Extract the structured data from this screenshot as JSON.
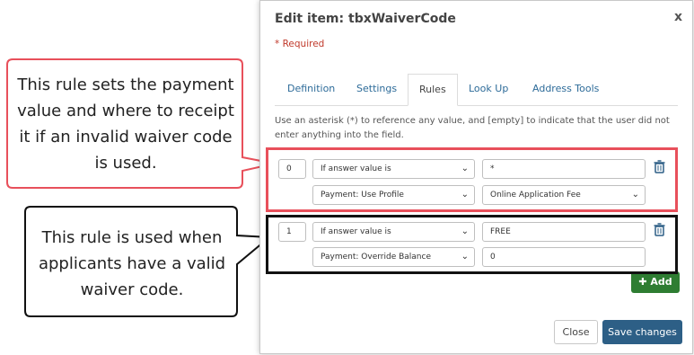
{
  "modal": {
    "title": "Edit item: tbxWaiverCode",
    "close_glyph": "x",
    "required_note": "* Required",
    "tabs": [
      {
        "label": "Definition",
        "active": false
      },
      {
        "label": "Settings",
        "active": false
      },
      {
        "label": "Rules",
        "active": true
      },
      {
        "label": "Look Up",
        "active": false
      },
      {
        "label": "Address Tools",
        "active": false
      }
    ],
    "instructions": "Use an asterisk (*) to reference any value, and [empty] to indicate that the user did not enter anything into the field.",
    "rules": [
      {
        "order": "0",
        "condition": "If answer value is",
        "value": "*",
        "action": "Payment: Use Profile",
        "action_value": "Online Application Fee"
      },
      {
        "order": "1",
        "condition": "If answer value is",
        "value": "FREE",
        "action": "Payment: Override Balance",
        "action_value": "0"
      }
    ],
    "add_label": "Add",
    "close_label": "Close",
    "save_label": "Save changes",
    "colors": {
      "add": "#2e7d32",
      "save": "#2d5f86",
      "link": "#2d6b99",
      "required": "#c0392b"
    }
  },
  "callouts": [
    {
      "text": "This rule sets the payment value and where to receipt it if an invalid waiver code is used.",
      "border": "#e8505b"
    },
    {
      "text": "This rule is used when applicants have a valid waiver code.",
      "border": "#111111"
    }
  ],
  "icons": [
    "close-icon",
    "trash-icon",
    "chevron-down-icon",
    "plus-icon"
  ]
}
